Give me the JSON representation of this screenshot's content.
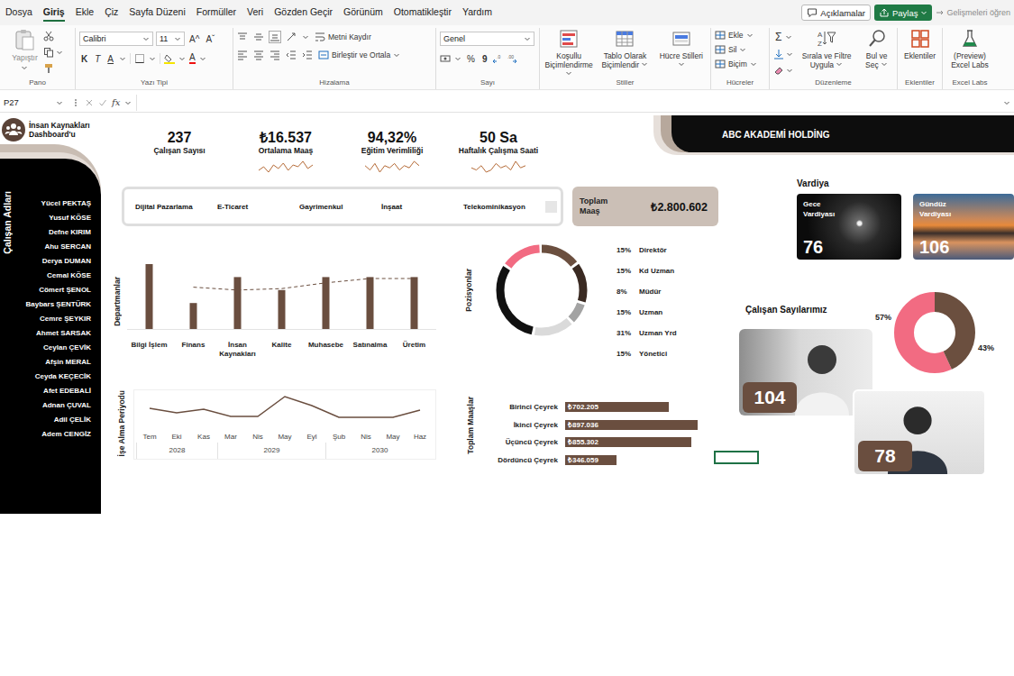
{
  "menu": {
    "tabs": [
      {
        "label": "Dosya",
        "selected": false
      },
      {
        "label": "Giriş",
        "selected": true
      },
      {
        "label": "Ekle",
        "selected": false
      },
      {
        "label": "Çiz",
        "selected": false
      },
      {
        "label": "Sayfa Düzeni",
        "selected": false
      },
      {
        "label": "Formüller",
        "selected": false
      },
      {
        "label": "Veri",
        "selected": false
      },
      {
        "label": "Gözden Geçir",
        "selected": false
      },
      {
        "label": "Görünüm",
        "selected": false
      },
      {
        "label": "Otomatikleştir",
        "selected": false
      },
      {
        "label": "Yardım",
        "selected": false
      }
    ],
    "comments": "Açıklamalar",
    "share": "Paylaş",
    "learn": "Gelişmeleri öğren"
  },
  "ribbon": {
    "clipboard": {
      "paste": "Yapıştır",
      "label": "Pano"
    },
    "font": {
      "family": "Calibri",
      "size": "11",
      "grow": "A^",
      "shrink": "Aˇ",
      "bold": "K",
      "italic": "T",
      "underline": "A",
      "color": "A",
      "label": "Yazı Tipi"
    },
    "alignment": {
      "wrap": "Metni Kaydır",
      "merge": "Birleştir ve Ortala",
      "label": "Hizalama"
    },
    "number": {
      "format": "Genel",
      "percent": "%",
      "comma": "9",
      "label": "Sayı"
    },
    "styles": {
      "buttons": [
        "Koşullu Biçimlendirme",
        "Tablo Olarak Biçimlendir",
        "Hücre Stilleri"
      ],
      "label": "Stiller"
    },
    "cells": {
      "buttons": [
        "Ekle",
        "Sil",
        "Biçim"
      ],
      "label": "Hücreler"
    },
    "editing": {
      "sum": "Σ",
      "buttons": [
        "Sırala ve Filtre Uygula",
        "Bul ve Seç"
      ],
      "label": "Düzenleme"
    },
    "addins": {
      "button": "Eklentiler",
      "label": "Eklentiler"
    },
    "labs": {
      "button": "(Preview) Excel Labs",
      "label": "Excel Labs"
    }
  },
  "formula_bar": {
    "cell": "P27",
    "fx": "fx"
  },
  "dashboard": {
    "title": "İnsan Kaynakları Dashboard'u",
    "company": "ABC AKADEMİ HOLDİNG",
    "kpis": [
      {
        "value": "237",
        "label": "Çalışan Sayısı",
        "trend": []
      },
      {
        "value": "₺16.537",
        "label": "Ortalama Maaş",
        "trend": [
          5,
          7,
          4,
          8,
          6,
          9,
          5,
          8,
          7,
          10,
          6,
          8
        ]
      },
      {
        "value": "94,32%",
        "label": "Eğitim Verimliliği",
        "trend": [
          7,
          5,
          8,
          4,
          7,
          6,
          8,
          5,
          7,
          6,
          9,
          7
        ]
      },
      {
        "value": "50 Sa",
        "label": "Haftalık Çalışma Saati",
        "trend": [
          6,
          5,
          7,
          4,
          5,
          8,
          6,
          7,
          5,
          9,
          6,
          7
        ]
      }
    ],
    "employees_label": "Çalışan Adları",
    "employees": [
      "Yücel PEKTAŞ",
      "Yusuf KÖSE",
      "Defne KIRIM",
      "Ahu SERCAN",
      "Derya DUMAN",
      "Cemal KÖSE",
      "Cömert ŞENOL",
      "Baybars ŞENTÜRK",
      "Cemre ŞEYKIR",
      "Ahmet SARSAK",
      "Ceylan ÇEVİK",
      "Afşin MERAL",
      "Ceyda KEÇECİK",
      "Afet EDEBALİ",
      "Adnan ÇUVAL",
      "Adil ÇELİK",
      "Adem CENGİZ"
    ],
    "sectors": [
      {
        "label": "Dijital Pazarlama",
        "selected": false
      },
      {
        "label": "E-Ticaret",
        "selected": false
      },
      {
        "label": "Gayrimenkul",
        "selected": false
      },
      {
        "label": "İnşaat",
        "selected": false
      },
      {
        "label": "Telekominikasyon",
        "selected": false
      }
    ],
    "total_salary": {
      "label": "Toplam Maaş",
      "value": "₺2.800.602"
    },
    "shifts": {
      "title": "Vardiya",
      "items": [
        {
          "label": "Gece Vardiyası",
          "count": "76",
          "kind": "night"
        },
        {
          "label": "Gündüz Vardiyası",
          "count": "106",
          "kind": "day"
        }
      ]
    },
    "departments": {
      "title": "Departmanlar",
      "categories": [
        "Bilgi İşlem",
        "Finans",
        "İnsan Kaynakları",
        "Kalite",
        "Muhasebe",
        "Satınalma",
        "Üretim"
      ],
      "bars": [
        45,
        18,
        36,
        27,
        36,
        36,
        36
      ],
      "line": [
        null,
        29,
        27,
        28,
        32,
        35,
        35
      ]
    },
    "positions": {
      "title": "Pozisyonlar",
      "items": [
        {
          "percent": "15%",
          "label": "Direktör",
          "value": 15,
          "color": "#6b4f3f"
        },
        {
          "percent": "15%",
          "label": "Kd Uzman",
          "value": 15,
          "color": "#3a2a22"
        },
        {
          "percent": "8%",
          "label": "Müdür",
          "value": 8,
          "color": "#a3a3a3"
        },
        {
          "percent": "15%",
          "label": "Uzman",
          "value": 15,
          "color": "#dadada"
        },
        {
          "percent": "31%",
          "label": "Uzman Yrd",
          "value": 31,
          "color": "#111111"
        },
        {
          "percent": "15%",
          "label": "Yönetici",
          "value": 15,
          "color": "#f26b82"
        }
      ]
    },
    "hiring": {
      "title": "İşe Alma Periyodu",
      "months": [
        "Tem",
        "Eki",
        "Kas",
        "Mar",
        "Nis",
        "May",
        "Eyl",
        "Şub",
        "Nis",
        "May",
        "Haz"
      ],
      "years": [
        {
          "label": "2028",
          "months": 3
        },
        {
          "label": "2029",
          "months": 4
        },
        {
          "label": "2030",
          "months": 4
        }
      ],
      "values": [
        20,
        15,
        19,
        11,
        11,
        33,
        23,
        10,
        10,
        10,
        18
      ]
    },
    "quarters": {
      "title": "Toplam Maaşlar",
      "items": [
        {
          "label": "Birinci Çeyrek",
          "value": "₺702.205",
          "amount": 702205
        },
        {
          "label": "İkinci Çeyrek",
          "value": "₺897.036",
          "amount": 897036
        },
        {
          "label": "Üçüncü Çeyrek",
          "value": "₺855.302",
          "amount": 855302
        },
        {
          "label": "Dördüncü Çeyrek",
          "value": "₺346.059",
          "amount": 346059
        }
      ]
    },
    "headcount": {
      "title": "Çalışan Sayılarımız",
      "shares": [
        {
          "percent": "57%",
          "value": 57,
          "color": "#f26b82"
        },
        {
          "percent": "43%",
          "value": 43,
          "color": "#6b4f3f"
        }
      ],
      "people": [
        {
          "count": "104"
        },
        {
          "count": "78"
        }
      ]
    }
  }
}
